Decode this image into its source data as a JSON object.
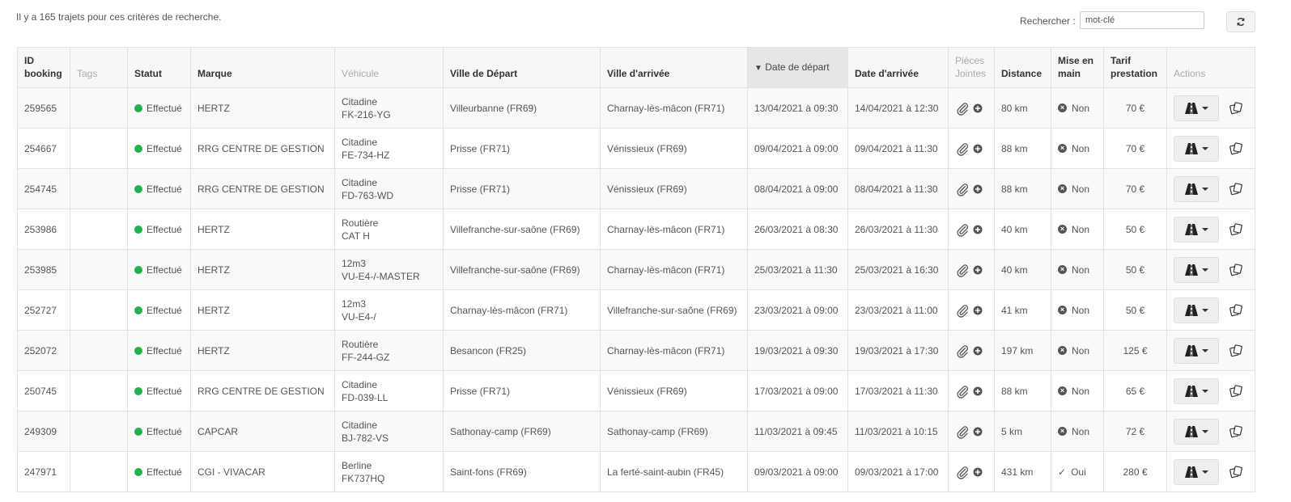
{
  "summary": {
    "text": "Il y a 165 trajets pour ces critères de recherche."
  },
  "search": {
    "label": "Rechercher :",
    "value": "mot-clé"
  },
  "columns": {
    "id": "ID booking",
    "tags": "Tags",
    "status": "Statut",
    "brand": "Marque",
    "vehicle": "Véhicule",
    "departure_city": "Ville de Départ",
    "arrival_city": "Ville d'arrivée",
    "departure_date": "Date de départ",
    "arrival_date": "Date d'arrivée",
    "attachments": "Pièces Jointes",
    "distance": "Distance",
    "handover": "Mise en main",
    "price": "Tarif prestation",
    "actions": "Actions"
  },
  "sort": {
    "column": "departure_date",
    "direction": "desc"
  },
  "rows": [
    {
      "id": "259565",
      "tags": "",
      "status": "Effectué",
      "brand": "HERTZ",
      "vehicle_type": "Citadine",
      "vehicle_plate": "FK-216-YG",
      "departure_city": "Villeurbanne (FR69)",
      "arrival_city": "Charnay-lès-mâcon (FR71)",
      "departure_date": "13/04/2021 à 09:30",
      "arrival_date": "14/04/2021 à 12:30",
      "distance": "80 km",
      "handover": "Non",
      "price": "70 €"
    },
    {
      "id": "254667",
      "tags": "",
      "status": "Effectué",
      "brand": "RRG CENTRE DE GESTION",
      "vehicle_type": "Citadine",
      "vehicle_plate": "FE-734-HZ",
      "departure_city": "Prisse (FR71)",
      "arrival_city": "Vénissieux (FR69)",
      "departure_date": "09/04/2021 à 09:00",
      "arrival_date": "09/04/2021 à 11:30",
      "distance": "88 km",
      "handover": "Non",
      "price": "70 €"
    },
    {
      "id": "254745",
      "tags": "",
      "status": "Effectué",
      "brand": "RRG CENTRE DE GESTION",
      "vehicle_type": "Citadine",
      "vehicle_plate": "FD-763-WD",
      "departure_city": "Prisse (FR71)",
      "arrival_city": "Vénissieux (FR69)",
      "departure_date": "08/04/2021 à 09:00",
      "arrival_date": "08/04/2021 à 11:30",
      "distance": "88 km",
      "handover": "Non",
      "price": "70 €"
    },
    {
      "id": "253986",
      "tags": "",
      "status": "Effectué",
      "brand": "HERTZ",
      "vehicle_type": "Routière",
      "vehicle_plate": "CAT H",
      "departure_city": "Villefranche-sur-saône (FR69)",
      "arrival_city": "Charnay-lès-mâcon (FR71)",
      "departure_date": "26/03/2021 à 08:30",
      "arrival_date": "26/03/2021 à 11:30",
      "distance": "40 km",
      "handover": "Non",
      "price": "50 €"
    },
    {
      "id": "253985",
      "tags": "",
      "status": "Effectué",
      "brand": "HERTZ",
      "vehicle_type": "12m3",
      "vehicle_plate": "VU-E4-/-MASTER",
      "departure_city": "Villefranche-sur-saône (FR69)",
      "arrival_city": "Charnay-lès-mâcon (FR71)",
      "departure_date": "25/03/2021 à 11:30",
      "arrival_date": "25/03/2021 à 16:30",
      "distance": "40 km",
      "handover": "Non",
      "price": "50 €"
    },
    {
      "id": "252727",
      "tags": "",
      "status": "Effectué",
      "brand": "HERTZ",
      "vehicle_type": "12m3",
      "vehicle_plate": "VU-E4-/",
      "departure_city": "Charnay-lès-mâcon (FR71)",
      "arrival_city": "Villefranche-sur-saône (FR69)",
      "departure_date": "23/03/2021 à 09:00",
      "arrival_date": "23/03/2021 à 11:00",
      "distance": "41 km",
      "handover": "Non",
      "price": "50 €"
    },
    {
      "id": "252072",
      "tags": "",
      "status": "Effectué",
      "brand": "HERTZ",
      "vehicle_type": "Routière",
      "vehicle_plate": "FF-244-GZ",
      "departure_city": "Besancon (FR25)",
      "arrival_city": "Charnay-lès-mâcon (FR71)",
      "departure_date": "19/03/2021 à 09:30",
      "arrival_date": "19/03/2021 à 17:30",
      "distance": "197 km",
      "handover": "Non",
      "price": "125 €"
    },
    {
      "id": "250745",
      "tags": "",
      "status": "Effectué",
      "brand": "RRG CENTRE DE GESTION",
      "vehicle_type": "Citadine",
      "vehicle_plate": "FD-039-LL",
      "departure_city": "Prisse (FR71)",
      "arrival_city": "Vénissieux (FR69)",
      "departure_date": "17/03/2021 à 09:00",
      "arrival_date": "17/03/2021 à 11:30",
      "distance": "88 km",
      "handover": "Non",
      "price": "65 €"
    },
    {
      "id": "249309",
      "tags": "",
      "status": "Effectué",
      "brand": "CAPCAR",
      "vehicle_type": "Citadine",
      "vehicle_plate": "BJ-782-VS",
      "departure_city": "Sathonay-camp (FR69)",
      "arrival_city": "Sathonay-camp (FR69)",
      "departure_date": "11/03/2021 à 09:45",
      "arrival_date": "11/03/2021 à 10:15",
      "distance": "5 km",
      "handover": "Non",
      "price": "72 €"
    },
    {
      "id": "247971",
      "tags": "",
      "status": "Effectué",
      "brand": "CGI - VIVACAR",
      "vehicle_type": "Berline",
      "vehicle_plate": "FK737HQ",
      "departure_city": "Saint-fons (FR69)",
      "arrival_city": "La ferté-saint-aubin (FR45)",
      "departure_date": "09/03/2021 à 09:00",
      "arrival_date": "09/03/2021 à 17:00",
      "distance": "431 km",
      "handover": "Oui",
      "price": "280 €"
    }
  ],
  "icons": {
    "status": "status-dot-icon",
    "attachment": "paperclip-icon",
    "add": "plus-circle-icon",
    "handover_no": "x-circle-icon",
    "handover_yes": "check-icon",
    "action_menu": "road-icon",
    "action_docs": "copy-icon",
    "refresh": "refresh-icon"
  },
  "colors": {
    "status_done": "#22b14c",
    "sorted_header": "#e6e6e6"
  }
}
